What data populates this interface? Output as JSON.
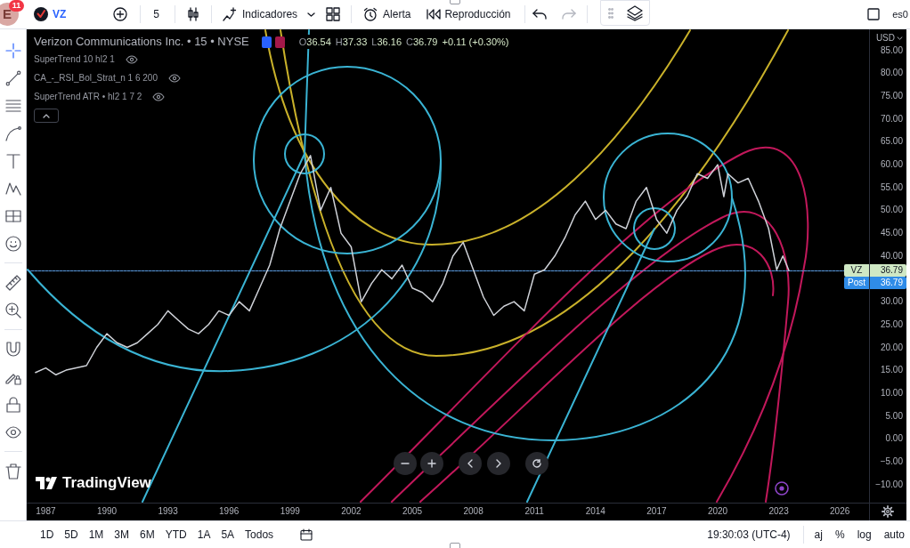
{
  "top_toolbar": {
    "avatar_letter": "E",
    "notification_count": "11",
    "symbol": "VZ",
    "interval": "5",
    "indicators": "Indicadores",
    "alert": "Alerta",
    "replay": "Reproducción",
    "right_text": "es0"
  },
  "left_toolbar": {
    "tools": [
      {
        "selected": true
      },
      {
        "selected": false
      },
      {
        "selected": false
      },
      {
        "selected": false
      },
      {
        "selected": false
      },
      {
        "selected": false
      },
      {
        "selected": false
      },
      {
        "selected": false
      },
      {
        "selected": false
      },
      {
        "selected": false
      },
      {
        "selected": false
      },
      {
        "selected": false
      },
      {
        "selected": false
      },
      {
        "selected": false
      },
      {
        "selected": false
      }
    ]
  },
  "chart": {
    "legend": {
      "chips": [
        {
          "color": "#2962ff"
        },
        {
          "color": "#a3184a"
        }
      ],
      "ohlc": [
        {
          "label": "O",
          "value": "36.54"
        },
        {
          "label": "H",
          "value": "37.33"
        },
        {
          "label": "L",
          "value": "36.16"
        },
        {
          "label": "C",
          "value": "36.79"
        }
      ],
      "change": "+0.11 (+0.30%)",
      "indicators": [
        {
          "name": "SuperTrend 10 hl2 1"
        },
        {
          "name": "CA_-_RSI_Bol_Strat_n 1 6 200"
        },
        {
          "name": "SuperTrend ATR • hl2 1 7 2"
        }
      ]
    },
    "currency": "USD",
    "price_labels": [
      {
        "kind": "last",
        "value": "36.79"
      },
      {
        "kind": "post",
        "label": "Post",
        "value": "36.79"
      }
    ],
    "logo": "TradingView",
    "chart_data": {
      "type": "line",
      "title": "Verizon Communications Inc. • 15 • NYSE",
      "x": [
        1986.5,
        1987,
        1987.5,
        1988,
        1988.5,
        1989,
        1989.5,
        1990,
        1990.5,
        1991,
        1991.5,
        1992,
        1992.5,
        1993,
        1993.5,
        1994,
        1994.5,
        1995,
        1995.5,
        1996,
        1996.5,
        1997,
        1997.5,
        1998,
        1998.5,
        1999,
        1999.5,
        2000,
        2000.5,
        2001,
        2001.5,
        2002,
        2002.5,
        2003,
        2003.5,
        2004,
        2004.5,
        2005,
        2005.5,
        2006,
        2006.5,
        2007,
        2007.5,
        2008,
        2008.5,
        2009,
        2009.5,
        2010,
        2010.5,
        2011,
        2011.5,
        2012,
        2012.5,
        2013,
        2013.5,
        2014,
        2014.5,
        2015,
        2015.5,
        2016,
        2016.5,
        2017,
        2017.5,
        2018,
        2018.5,
        2019,
        2019.5,
        2020,
        2020.3,
        2020.5,
        2021,
        2021.5,
        2022,
        2022.5,
        2022.9,
        2023.2,
        2023.5
      ],
      "series": [
        {
          "name": "VZ",
          "color": "#cfd2d8",
          "values": [
            14.5,
            15.5,
            14,
            15,
            15.5,
            16,
            20,
            23,
            21,
            20,
            21,
            23,
            25,
            28,
            26,
            24,
            23,
            25,
            28,
            27,
            30,
            28,
            33,
            38,
            46,
            52,
            58,
            62,
            50,
            55,
            45,
            42,
            30,
            34,
            37,
            35,
            38,
            33,
            32,
            30,
            34,
            40,
            43,
            37,
            31,
            27,
            29,
            30,
            28,
            36,
            37,
            40,
            44,
            49,
            52,
            48,
            50,
            47,
            46,
            52,
            55,
            48,
            45,
            50,
            53,
            58,
            57,
            60,
            53,
            58,
            56,
            57,
            52,
            46,
            37,
            40,
            36.8
          ]
        }
      ],
      "xlim": [
        1986.065,
        2029.27
      ],
      "ylim": [
        -17.88,
        89.61
      ],
      "xticks": [
        {
          "value": 1987,
          "label": "1987"
        },
        {
          "value": 1990,
          "label": "1990"
        },
        {
          "value": 1993,
          "label": "1993"
        },
        {
          "value": 1996,
          "label": "1996"
        },
        {
          "value": 1999,
          "label": "1999"
        },
        {
          "value": 2002,
          "label": "2002"
        },
        {
          "value": 2005,
          "label": "2005"
        },
        {
          "value": 2008,
          "label": "2008"
        },
        {
          "value": 2011,
          "label": "2011"
        },
        {
          "value": 2014,
          "label": "2014"
        },
        {
          "value": 2017,
          "label": "2017"
        },
        {
          "value": 2020,
          "label": "2020"
        },
        {
          "value": 2023,
          "label": "2023"
        },
        {
          "value": 2026,
          "label": "2026"
        }
      ],
      "yticks": [
        {
          "value": 85,
          "label": "85.00"
        },
        {
          "value": 80,
          "label": "80.00"
        },
        {
          "value": 75,
          "label": "75.00"
        },
        {
          "value": 70,
          "label": "70.00"
        },
        {
          "value": 65,
          "label": "65.00"
        },
        {
          "value": 60,
          "label": "60.00"
        },
        {
          "value": 55,
          "label": "55.00"
        },
        {
          "value": 50,
          "label": "50.00"
        },
        {
          "value": 45,
          "label": "45.00"
        },
        {
          "value": 40,
          "label": "40.00"
        },
        {
          "value": 30,
          "label": "30.00"
        },
        {
          "value": 25,
          "label": "25.00"
        },
        {
          "value": 20,
          "label": "20.00"
        },
        {
          "value": 15,
          "label": "15.00"
        },
        {
          "value": 10,
          "label": "10.00"
        },
        {
          "value": 5,
          "label": "5.00"
        },
        {
          "value": 0,
          "label": "0.00"
        },
        {
          "value": -5,
          "label": "−5.00"
        },
        {
          "value": -10,
          "label": "−10.00"
        }
      ]
    }
  },
  "bottom_toolbar": {
    "ranges": [
      "1D",
      "5D",
      "1M",
      "3M",
      "6M",
      "YTD",
      "1A",
      "5A",
      "Todos"
    ],
    "time": "19:30:03 (UTC-4)",
    "scale_options": [
      "aj",
      "%",
      "log",
      "auto"
    ]
  }
}
